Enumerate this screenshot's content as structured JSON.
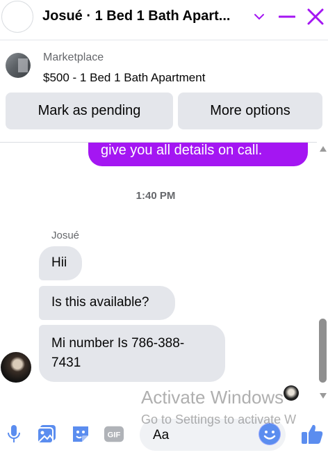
{
  "header": {
    "title": "Josué · 1 Bed 1 Bath Apart...",
    "accent": "#a416f2"
  },
  "listing": {
    "category": "Marketplace",
    "title": "$500 - 1 Bed 1 Bath Apartment",
    "buttons": {
      "pending": "Mark as pending",
      "more": "More options"
    }
  },
  "conversation": {
    "outgoing_tail": "give you all details on call.",
    "timestamp": "1:40 PM",
    "sender_name": "Josué",
    "messages": [
      {
        "lines": [
          "Hii"
        ]
      },
      {
        "lines": [
          "Is this available?"
        ]
      },
      {
        "lines": [
          "Mi number Is 786-388-",
          "7431"
        ]
      }
    ]
  },
  "composer": {
    "placeholder": "Aa",
    "tools": [
      "microphone-icon",
      "photo-icon",
      "sticker-icon",
      "gif-icon"
    ],
    "gif_label": "GIF"
  },
  "watermark": {
    "line1": "Activate Windows",
    "line2": "Go to Settings to activate W"
  },
  "colors": {
    "outgoing_bubble": "#a416f2",
    "incoming_bubble": "#e4e6eb",
    "tool_blue": "#5b8def"
  }
}
